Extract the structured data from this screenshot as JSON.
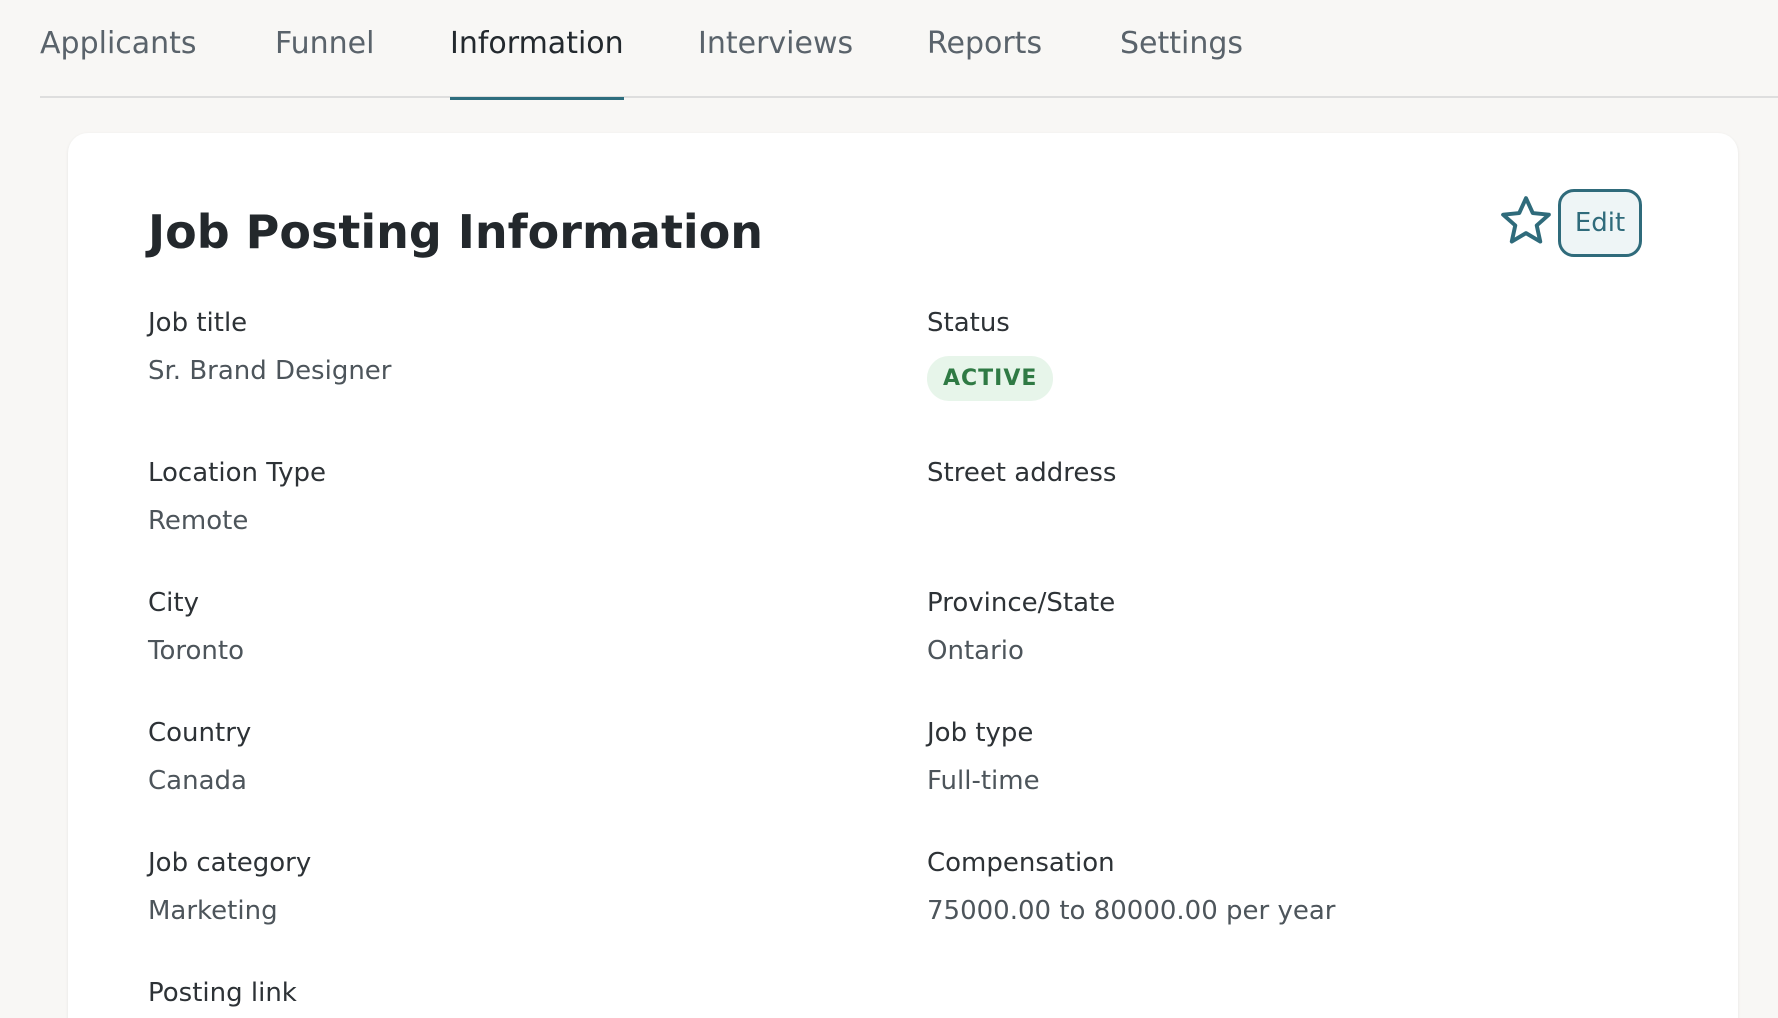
{
  "tabs": [
    {
      "label": "Applicants"
    },
    {
      "label": "Funnel"
    },
    {
      "label": "Information",
      "active": true
    },
    {
      "label": "Interviews"
    },
    {
      "label": "Reports"
    },
    {
      "label": "Settings"
    }
  ],
  "card": {
    "title": "Job Posting Information",
    "star_icon": "star-outline-icon",
    "edit_label": "Edit"
  },
  "fields": {
    "job_title": {
      "label": "Job title",
      "value": "Sr. Brand Designer"
    },
    "status": {
      "label": "Status",
      "value": "ACTIVE"
    },
    "location_type": {
      "label": "Location Type",
      "value": "Remote"
    },
    "street_address": {
      "label": "Street address",
      "value": ""
    },
    "city": {
      "label": "City",
      "value": "Toronto"
    },
    "province_state": {
      "label": "Province/State",
      "value": "Ontario"
    },
    "country": {
      "label": "Country",
      "value": "Canada"
    },
    "job_type": {
      "label": "Job type",
      "value": "Full-time"
    },
    "job_category": {
      "label": "Job category",
      "value": "Marketing"
    },
    "compensation": {
      "label": "Compensation",
      "value": "75000.00 to 80000.00 per year"
    },
    "posting_link": {
      "label": "Posting link"
    }
  },
  "colors": {
    "accent": "#2f6b7b",
    "badge_bg": "#e7f5ea",
    "badge_text": "#2f7a44",
    "page_bg": "#f8f7f5"
  }
}
